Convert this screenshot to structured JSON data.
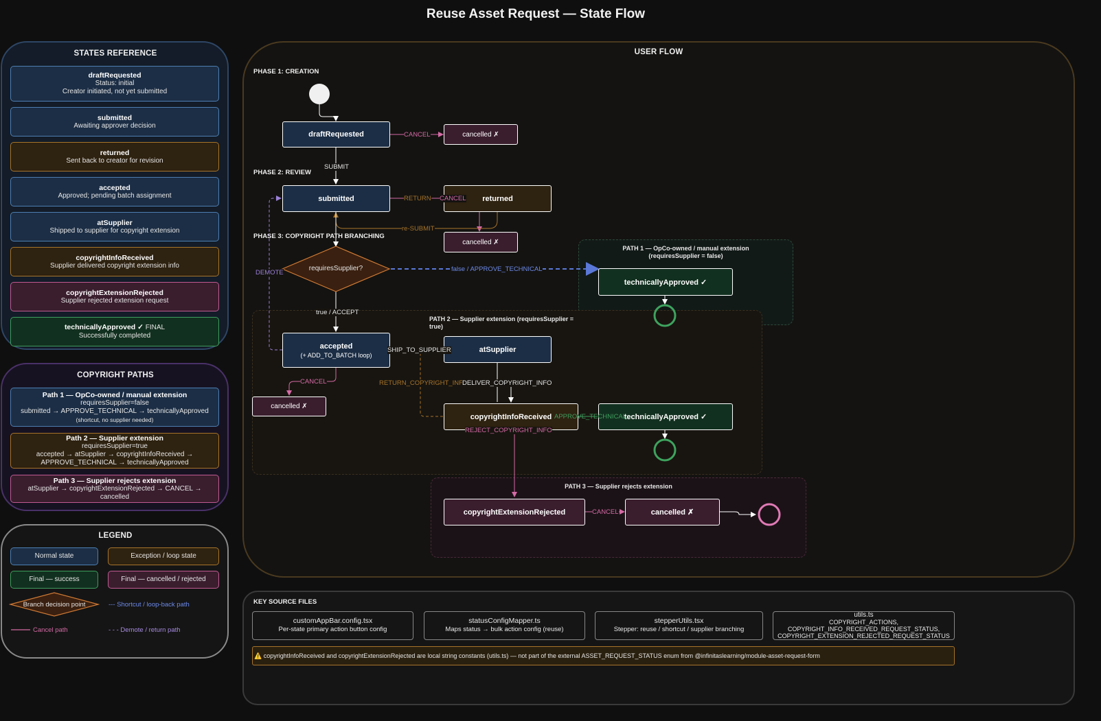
{
  "title": "Reuse Asset Request — State Flow",
  "states_reference": {
    "title": "STATES REFERENCE",
    "items": [
      {
        "name": "draftRequested",
        "lines": [
          "Status: initial",
          "Creator initiated, not yet submitted"
        ]
      },
      {
        "name": "submitted",
        "lines": [
          "Awaiting approver decision"
        ]
      },
      {
        "name": "returned",
        "lines": [
          "Sent back to creator for revision"
        ]
      },
      {
        "name": "accepted",
        "lines": [
          "Approved; pending batch assignment"
        ]
      },
      {
        "name": "atSupplier",
        "lines": [
          "Shipped to supplier for copyright extension"
        ]
      },
      {
        "name": "copyrightInfoReceived",
        "lines": [
          "Supplier delivered copyright extension info"
        ]
      },
      {
        "name": "copyrightExtensionRejected",
        "lines": [
          "Supplier rejected extension request"
        ]
      },
      {
        "name": "technicallyApproved ✓",
        "suffix": " FINAL",
        "lines": [
          "Successfully completed"
        ]
      }
    ]
  },
  "copyright_paths": {
    "title": "COPYRIGHT PATHS",
    "items": [
      {
        "name": "Path 1 — OpCo-owned / manual extension",
        "lines": [
          "requiresSupplier=false",
          "submitted → APPROVE_TECHNICAL → technicallyApproved",
          "(shortcut, no supplier needed)"
        ]
      },
      {
        "name": "Path 2 — Supplier extension",
        "lines": [
          "requiresSupplier=true",
          "accepted → atSupplier → copyrightInfoReceived →",
          "APPROVE_TECHNICAL → technicallyApproved"
        ]
      },
      {
        "name": "Path 3 — Supplier rejects extension",
        "lines": [
          "atSupplier → copyrightExtensionRejected → CANCEL → cancelled"
        ]
      }
    ]
  },
  "legend": {
    "title": "LEGEND",
    "normal": "Normal state",
    "exception": "Exception / loop state",
    "success": "Final — success",
    "cancelled": "Final — cancelled / rejected",
    "decision": "Branch decision point",
    "shortcut": "Shortcut / loop-back path",
    "cancel_path": "Cancel path",
    "demote": "Demote / return path"
  },
  "flow": {
    "title": "USER FLOW",
    "phase1": "PHASE 1: CREATION",
    "phase2": "PHASE 2: REVIEW",
    "phase3": "PHASE 3: COPYRIGHT PATH BRANCHING",
    "path1_title": "PATH 1 — OpCo-owned / manual extension",
    "path1_sub": "(requiresSupplier = false)",
    "path2_title": "PATH 2 — Supplier extension (requiresSupplier = true)",
    "path3_title": "PATH 3 — Supplier rejects extension",
    "nodes": {
      "draftRequested": "draftRequested",
      "cancelled1": "cancelled ✗",
      "submitted": "submitted",
      "returned": "returned",
      "cancelled2": "cancelled ✗",
      "decision": "requiresSupplier?",
      "techApproved1": "technicallyApproved ✓",
      "accepted": "accepted",
      "accepted_sub": "(+ ADD_TO_BATCH loop)",
      "atSupplier": "atSupplier",
      "cancelled3": "cancelled ✗",
      "copyrightInfoReceived": "copyrightInfoReceived",
      "techApproved2": "technicallyApproved ✓",
      "copyrightExtensionRejected": "copyrightExtensionRejected",
      "cancelled4": "cancelled ✗"
    },
    "edges": {
      "cancel1": "CANCEL",
      "submit": "SUBMIT",
      "return": "RETURN",
      "cancel2": "CANCEL",
      "resubmit": "re-SUBMIT",
      "demote": "DEMOTE",
      "false_approve": "false / APPROVE_TECHNICAL",
      "true_accept": "true / ACCEPT",
      "ship": "SHIP_TO_SUPPLIER",
      "cancel3": "CANCEL",
      "return_copyright": "RETURN_COPYRIGHT_INFO",
      "deliver_copyright": "DELIVER_COPYRIGHT_INFO",
      "approve_technical": "APPROVE_TECHNICAL",
      "reject_copyright": "REJECT_COPYRIGHT_INFO",
      "cancel4": "CANCEL"
    }
  },
  "key_files": {
    "title": "KEY SOURCE FILES",
    "files": [
      {
        "name": "customAppBar.config.tsx",
        "lines": [
          "Per-state primary action button config"
        ]
      },
      {
        "name": "statusConfigMapper.ts",
        "lines": [
          "Maps status → bulk action config (reuse)"
        ]
      },
      {
        "name": "stepperUtils.tsx",
        "lines": [
          "Stepper: reuse / shortcut / supplier branching"
        ]
      },
      {
        "name": "utils.ts",
        "lines": [
          "COPYRIGHT_ACTIONS,",
          "COPYRIGHT_INFO_RECEIVED_REQUEST_STATUS,",
          "COPYRIGHT_EXTENSION_REJECTED_REQUEST_STATUS"
        ]
      }
    ],
    "warning": "⚠️ copyrightInfoReceived and copyrightExtensionRejected are local string constants (utils.ts) — not part of the external ASSET_REQUEST_STATUS enum from @infinitaslearning/module-asset-request-form"
  },
  "colors": {
    "normal_fill": "#1c2e45",
    "normal_stroke": "#4d7fb4",
    "exception_fill": "#2e2210",
    "exception_stroke": "#a7742a",
    "success_fill": "#12301f",
    "success_stroke": "#3e9e5e",
    "cancel_fill": "#3a1e2e",
    "cancel_stroke": "#c05a92",
    "shortcut": "#5a78d8",
    "demote": "#9b80d8"
  }
}
